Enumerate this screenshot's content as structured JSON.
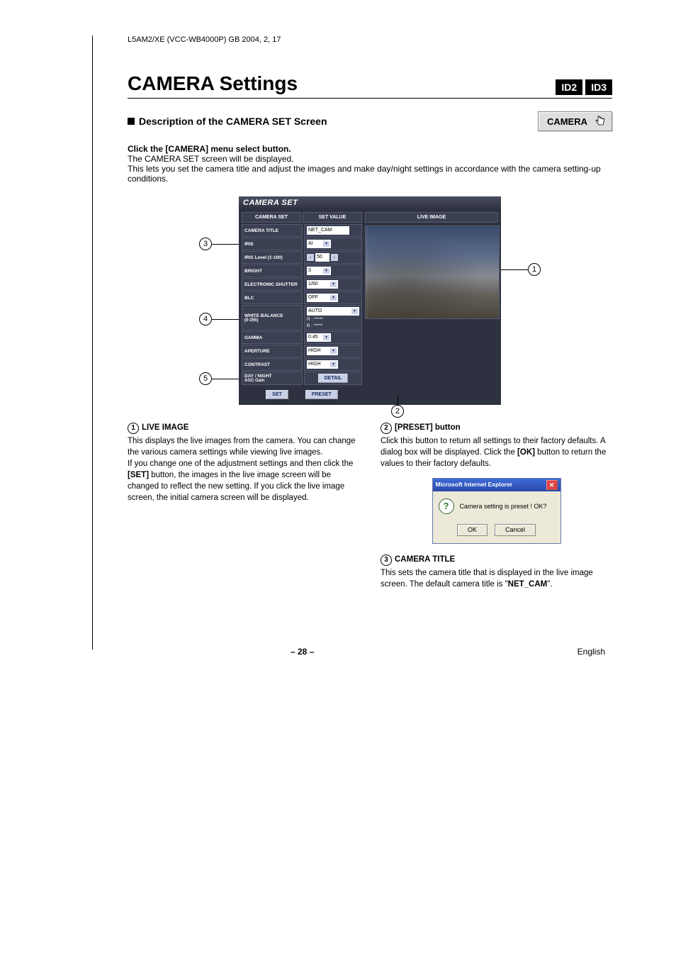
{
  "doc_header": "L5AM2/XE (VCC-WB4000P)    GB    2004, 2, 17",
  "title": "CAMERA Settings",
  "badges": [
    "ID2",
    "ID3"
  ],
  "subheading": "Description of the CAMERA SET Screen",
  "camera_button": "CAMERA",
  "instruction": {
    "line1": "Click the [CAMERA] menu select button.",
    "line2": "The CAMERA SET screen will be displayed.",
    "line3": "This lets you set the camera title and adjust the images and make day/night settings in accordance with the camera setting-up conditions."
  },
  "panel": {
    "title": "CAMERA SET",
    "hdr_left": "CAMERA SET",
    "hdr_right": "SET VALUE",
    "rows": {
      "camera_title": {
        "label": "CAMERA TITLE",
        "value": "NET_CAM"
      },
      "iris": {
        "label": "IRIS",
        "value": "AI"
      },
      "iris_level": {
        "label": "IRIS Level (1-100)",
        "value": "50"
      },
      "bright": {
        "label": "BRIGHT",
        "value": "3"
      },
      "e_shutter": {
        "label": "ELECTRONIC SHUTTER",
        "value": "1/60"
      },
      "blc": {
        "label": "BLC",
        "value": "OFF"
      },
      "wb": {
        "label": "WHITE BALANCE",
        "sublabel": "(0-255)",
        "mode": "AUTO",
        "r": "R :   *****",
        "b": "B :   *****"
      },
      "gamma": {
        "label": "GAMMA",
        "value": "0.45"
      },
      "aperture": {
        "label": "APERTURE",
        "value": "HIGH"
      },
      "contrast": {
        "label": "CONTRAST",
        "value": "HIGH"
      },
      "daynight": {
        "label": "DAY / NIGHT",
        "sublabel": "AGC Gain",
        "btn": "DETAIL"
      }
    },
    "actions": {
      "set": "SET",
      "preset": "PRESET"
    },
    "live": "LIVE IMAGE"
  },
  "callouts": {
    "c1": "1",
    "c2": "2",
    "c3": "3",
    "c4": "4",
    "c5": "5"
  },
  "items": {
    "i1": {
      "heading": "LIVE IMAGE",
      "p1": "This displays the live images from the camera. You can change the various camera settings while viewing live images.",
      "p2a": "If you change one of the adjustment settings and then click the ",
      "p2b": "[SET]",
      "p2c": " button, the images in the live image screen will be changed to reflect the new setting. If you click the live image screen, the initial camera screen will be displayed."
    },
    "i2": {
      "heading": "[PRESET] button",
      "p1a": "Click this button to return all settings to their factory defaults. A dialog box will be displayed. Click the ",
      "p1b": "[OK]",
      "p1c": " button to return the values to their factory defaults."
    },
    "i3": {
      "heading": "CAMERA TITLE",
      "p1a": "This sets the camera title that is displayed in the live image screen. The default camera title is \"",
      "p1b": "NET_CAM",
      "p1c": "\"."
    }
  },
  "dialog": {
    "title": "Microsoft Internet Explorer",
    "msg": "Camera setting is preset !   OK?",
    "ok": "OK",
    "cancel": "Cancel"
  },
  "footer": {
    "page": "– 28 –",
    "lang": "English"
  }
}
